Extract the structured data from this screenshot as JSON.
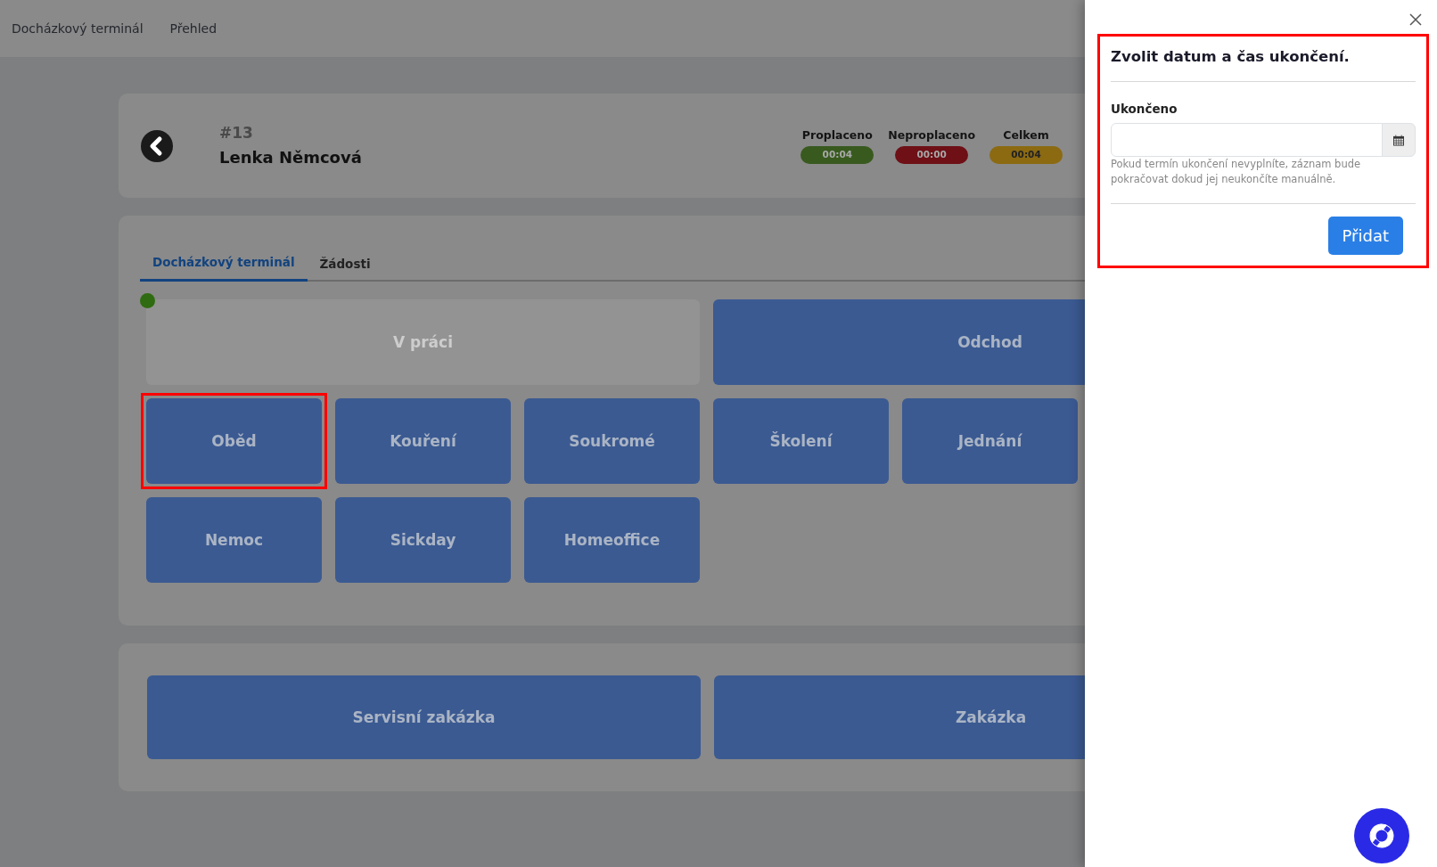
{
  "navbar": {
    "items": [
      {
        "label": "Docházkový terminál"
      },
      {
        "label": "Přehled"
      }
    ]
  },
  "employee": {
    "number": "#13",
    "name": "Lenka Němcová",
    "stats": [
      {
        "label": "Proplaceno",
        "value": "00:04",
        "color": "#385a1e"
      },
      {
        "label": "Neproplaceno",
        "value": "00:00",
        "color": "#6e1016"
      },
      {
        "label": "Celkem",
        "value": "00:04",
        "color": "#8c6a12"
      }
    ]
  },
  "tabs": [
    {
      "label": "Docházkový terminál",
      "selected": true
    },
    {
      "label": "Žádosti",
      "selected": false
    }
  ],
  "presence_indicator": {
    "on": true
  },
  "action_rows": [
    [
      {
        "label": "V práci",
        "kind": "wide",
        "disabled": true,
        "highlighted": false
      },
      {
        "label": "Odchod",
        "kind": "wide",
        "disabled": false,
        "highlighted": false
      }
    ],
    [
      {
        "label": "Oběd",
        "kind": "tile",
        "disabled": false,
        "highlighted": true
      },
      {
        "label": "Kouření",
        "kind": "tile",
        "disabled": false,
        "highlighted": false
      },
      {
        "label": "Soukromé",
        "kind": "tile",
        "disabled": false,
        "highlighted": false
      },
      {
        "label": "Školení",
        "kind": "tile",
        "disabled": false,
        "highlighted": false
      },
      {
        "label": "Jednání",
        "kind": "tile",
        "disabled": false,
        "highlighted": false
      }
    ],
    [
      {
        "label": "Nemoc",
        "kind": "tile",
        "disabled": false,
        "highlighted": false
      },
      {
        "label": "Sickday",
        "kind": "tile",
        "disabled": false,
        "highlighted": false
      },
      {
        "label": "Homeoffice",
        "kind": "tile",
        "disabled": false,
        "highlighted": false
      }
    ]
  ],
  "orders": [
    {
      "label": "Servisní zakázka"
    },
    {
      "label": "Zakázka"
    }
  ],
  "panel": {
    "highlighted": true,
    "title": "Zvolit datum a čas ukončení.",
    "field_label": "Ukončeno",
    "help": "Pokud termín ukončení nevyplníte, záznam bude pokračovat dokud jej neukončíte manuálně.",
    "button": "Přidat"
  }
}
